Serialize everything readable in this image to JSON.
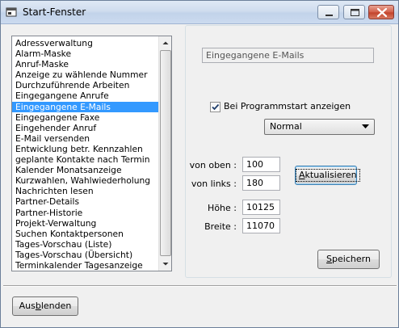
{
  "window": {
    "title": "Start-Fenster",
    "icon": "app-window-icon"
  },
  "list": {
    "items": [
      "Adressverwaltung",
      "Alarm-Maske",
      "Anruf-Maske",
      "Anzeige zu wählende Nummer",
      "Durchzuführende Arbeiten",
      "Eingegangene Anrufe",
      "Eingegangene E-Mails",
      "Eingegangene Faxe",
      "Eingehender Anruf",
      "E-Mail versenden",
      "Entwicklung betr. Kennzahlen",
      "geplante Kontakte nach Termin",
      "Kalender Monatsanzeige",
      "Kurzwahlen, Wahlwiederholung",
      "Nachrichten lesen",
      "Partner-Details",
      "Partner-Historie",
      "Projekt-Verwaltung",
      "Suchen Kontaktpersonen",
      "Tages-Vorschau (Liste)",
      "Tages-Vorschau (Übersicht)",
      "Terminkalender Tagesanzeige"
    ],
    "selected_index": 6
  },
  "details": {
    "selected_name": "Eingegangene E-Mails",
    "startup_checkbox": {
      "label": "Bei Programmstart anzeigen",
      "checked": true
    },
    "mode_select": {
      "value": "Normal"
    },
    "fields": {
      "top_label": "von oben :",
      "top_value": "100",
      "left_label": "von links :",
      "left_value": "180",
      "height_label": "Höhe :",
      "height_value": "10125",
      "width_label": "Breite :",
      "width_value": "11070"
    },
    "refresh_button": {
      "mnemonic": "A",
      "rest": "ktualisieren"
    },
    "save_button": {
      "mnemonic": "S",
      "rest": "peichern"
    }
  },
  "footer": {
    "hide_button": {
      "prefix": "Aus",
      "mnemonic": "b",
      "rest": "lenden"
    }
  },
  "colors": {
    "selection": "#3399ff",
    "window_bg": "#f0f0f0",
    "close_button": "#c2432c"
  }
}
